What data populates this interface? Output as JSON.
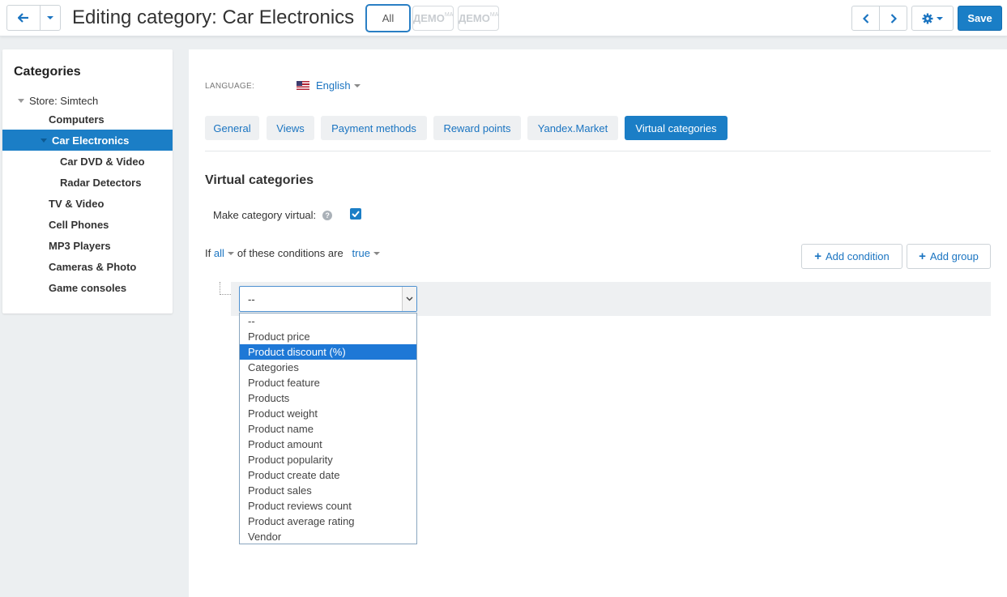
{
  "header": {
    "title": "Editing category: Car Electronics",
    "store_all_label": "All",
    "store_demo_1": "ДЕМО",
    "store_demo_1_sup": "МА",
    "store_demo_2": "ДЕМО",
    "store_demo_2_sup": "МА",
    "save_label": "Save"
  },
  "sidebar": {
    "title": "Categories",
    "items": [
      {
        "label": "Store: Simtech",
        "level": 0
      },
      {
        "label": "Computers",
        "level": 1
      },
      {
        "label": "Car Electronics",
        "level": 1,
        "active": true
      },
      {
        "label": "Car DVD & Video",
        "level": 2
      },
      {
        "label": "Radar Detectors",
        "level": 2
      },
      {
        "label": "TV & Video",
        "level": 1
      },
      {
        "label": "Cell Phones",
        "level": 1
      },
      {
        "label": "MP3 Players",
        "level": 1
      },
      {
        "label": "Cameras & Photo",
        "level": 1
      },
      {
        "label": "Game consoles",
        "level": 1
      }
    ]
  },
  "language": {
    "label": "LANGUAGE:",
    "value": "English"
  },
  "tabs": [
    {
      "label": "General"
    },
    {
      "label": "Views"
    },
    {
      "label": "Payment methods"
    },
    {
      "label": "Reward points"
    },
    {
      "label": "Yandex.Market"
    },
    {
      "label": "Virtual categories",
      "active": true
    }
  ],
  "content": {
    "section_title": "Virtual categories",
    "make_virtual_label": "Make category virtual:",
    "make_virtual_checked": true,
    "cond_if": "If",
    "cond_all": "all",
    "cond_middle": "of these conditions are",
    "cond_true": "true",
    "add_condition_label": "Add condition",
    "add_group_label": "Add group",
    "select_value": "--",
    "options": [
      "--",
      "Product price",
      "Product discount (%)",
      "Categories",
      "Product feature",
      "Products",
      "Product weight",
      "Product name",
      "Product amount",
      "Product popularity",
      "Product create date",
      "Product sales",
      "Product reviews count",
      "Product average rating",
      "Vendor"
    ],
    "highlighted_option": "Product discount (%)"
  },
  "colors": {
    "accent": "#1b7ec6",
    "link": "#1a74c1",
    "highlight": "#1e78d6"
  }
}
